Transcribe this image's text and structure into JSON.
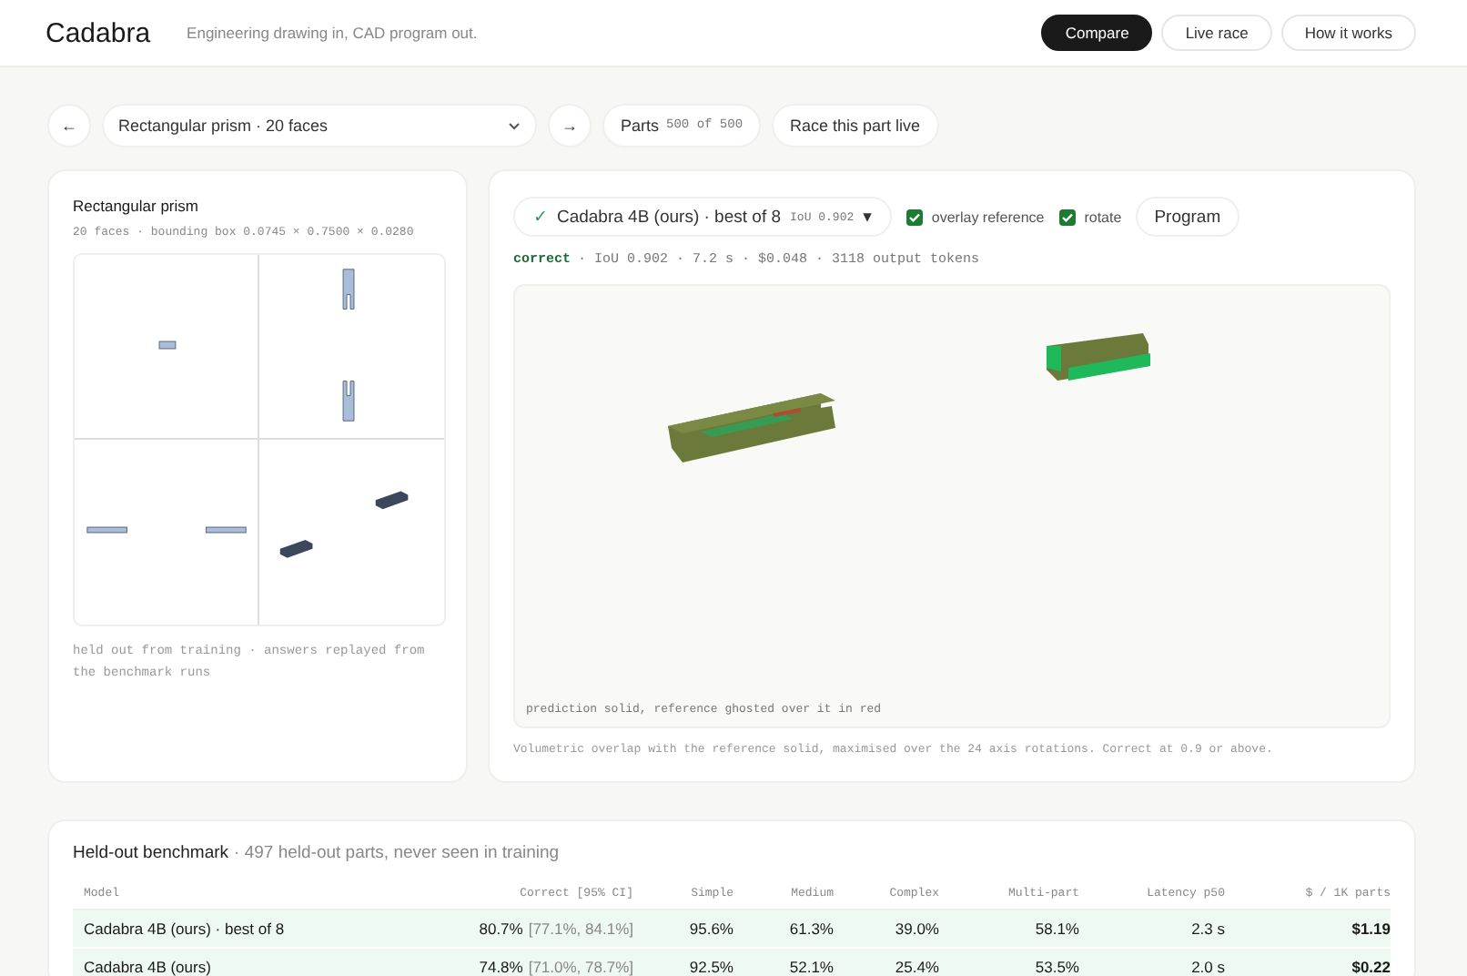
{
  "header": {
    "brand": "Cadabra",
    "tagline": "Engineering drawing in, CAD program out.",
    "nav": [
      {
        "label": "Compare",
        "selected": true
      },
      {
        "label": "Live race",
        "selected": false
      },
      {
        "label": "How it works",
        "selected": false
      }
    ]
  },
  "part_bar": {
    "prev": "←",
    "part": "Rectangular prism · 20 faces",
    "next": "→",
    "parts_label": "Parts",
    "parts_count": "500 of 500",
    "race": "Race this part live"
  },
  "drawing_card": {
    "title": "Rectangular prism",
    "meta": "20 faces · bounding box 0.0745 × 0.7500 × 0.0280",
    "note": "held out from training · answers replayed from the benchmark runs"
  },
  "result_card": {
    "model": {
      "check": "✓",
      "name": "Cadabra 4B (ours) · best of 8",
      "iou": "IoU 0.902",
      "caret": "▾"
    },
    "toggles": [
      {
        "label": "overlay reference",
        "checked": true
      },
      {
        "label": "rotate",
        "checked": true
      }
    ],
    "program": "Program",
    "status": {
      "verdict": "correct",
      "correct": true,
      "details": "· IoU 0.902 · 7.2 s · $0.048 · 3118 output tokens"
    },
    "viewer_caption": "prediction solid, reference ghosted over it in red",
    "footnote": "Volumetric overlap with the reference solid, maximised over the 24 axis rotations. Correct at 0.9 or above."
  },
  "benchmark": {
    "title": "Held-out benchmark",
    "subtitle": "· 497 held-out parts, never seen in training",
    "columns": [
      "Model",
      "Correct [95% CI]",
      "Simple",
      "Medium",
      "Complex",
      "Multi-part",
      "Latency p50",
      "$ / 1K parts"
    ],
    "rows": [
      {
        "ours": true,
        "cells": [
          {
            "text": "Cadabra 4B (ours) · best of 8"
          },
          {
            "text": "80.7%",
            "ci": "[77.1%, 84.1%]"
          },
          {
            "text": "95.6%"
          },
          {
            "text": "61.3%"
          },
          {
            "text": "39.0%"
          },
          {
            "text": "58.1%"
          },
          {
            "text": "2.3 s"
          },
          {
            "text": "$1.19"
          }
        ]
      },
      {
        "ours": true,
        "cells": [
          {
            "text": "Cadabra 4B (ours)"
          },
          {
            "text": "74.8%",
            "ci": "[71.0%, 78.7%]"
          },
          {
            "text": "92.5%"
          },
          {
            "text": "52.1%"
          },
          {
            "text": "25.4%"
          },
          {
            "text": "53.5%"
          },
          {
            "text": "2.0 s"
          },
          {
            "text": "$0.22"
          }
        ]
      }
    ]
  }
}
